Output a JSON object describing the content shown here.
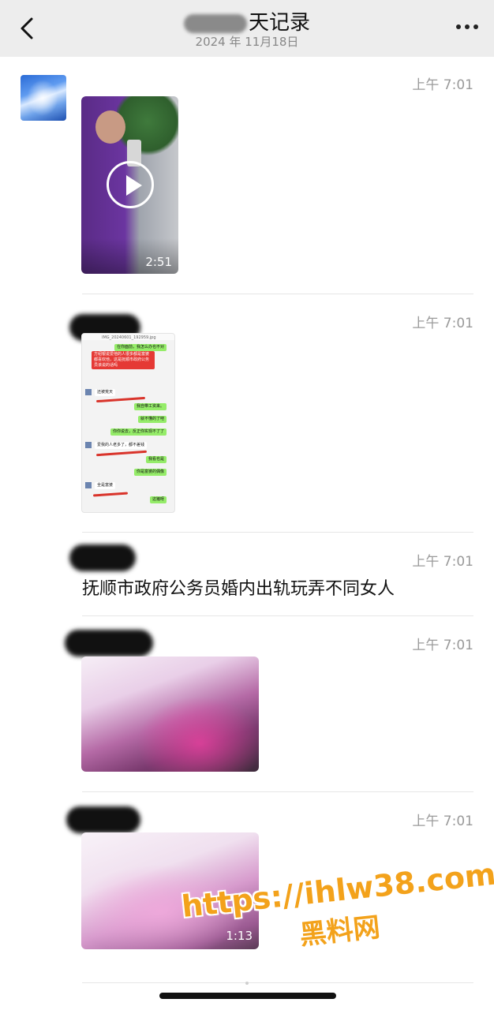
{
  "header": {
    "title": "聊天记录",
    "title_visible_part": "天记录",
    "date": "2024 年 11月18日",
    "back_icon": "chevron-left-icon",
    "more_icon": "more-dots-icon"
  },
  "messages": [
    {
      "type": "video",
      "time": "上午 7:01",
      "duration": "2:51"
    },
    {
      "type": "image",
      "time": "上午 7:01",
      "image": {
        "filename": "IMG_20240601_192959.jpg",
        "lines": [
          "在你面前，我怎么办也不对",
          "方绍银说爱他的人很多都是富婆都喜欢他，这是抚顺市政府公务员该说的话吗",
          "还被荒天",
          "我自带工资来。",
          "就不懂的了吧",
          "你你说去，反正你实现不了了",
          "爱我的人老多了，都不差钱",
          "我看也是",
          "你是富婆的偶像",
          "全是富婆",
          "这猪呀"
        ]
      }
    },
    {
      "type": "text",
      "time": "上午 7:01",
      "text": "抚顺市政府公务员婚内出轨玩弄不同女人"
    },
    {
      "type": "video",
      "time": "上午 7:01",
      "duration": ""
    },
    {
      "type": "video",
      "time": "上午 7:01",
      "duration": "1:13"
    }
  ],
  "watermark": {
    "url": "https://ihlw38.com",
    "name": "黑料网",
    "color": "#f3a21b"
  },
  "colors": {
    "header_bg": "#ededed",
    "time_text": "#9a9a9a"
  }
}
